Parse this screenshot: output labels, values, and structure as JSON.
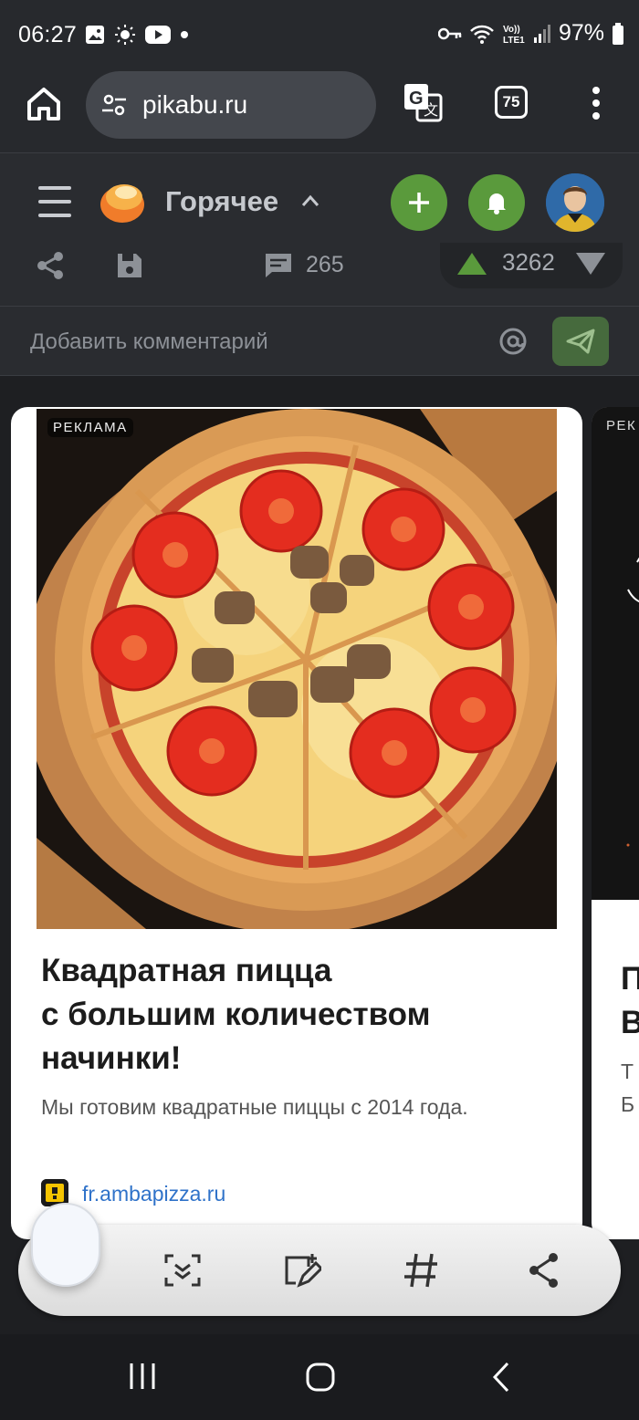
{
  "status_bar": {
    "time": "06:27",
    "battery": "97%",
    "left_icons": [
      "gallery-icon",
      "brightness-icon",
      "youtube-icon",
      "dot-icon"
    ],
    "right_icons": [
      "key-icon",
      "wifi-icon",
      "volte-lte-icon",
      "signal-icon",
      "battery-icon"
    ]
  },
  "browser": {
    "url": "pikabu.ru",
    "tab_count": "75"
  },
  "site_header": {
    "section": "Горячее"
  },
  "post_actions": {
    "comment_count": "265",
    "rating": "3262"
  },
  "comment_input": {
    "placeholder": "Добавить комментарий"
  },
  "ad": {
    "label": "РЕКЛАМА",
    "title_line1": "Квадратная пицца",
    "title_line2": "с большим количеством",
    "title_line3": "начинки!",
    "description": "Мы готовим квадратные пиццы с 2014 года.",
    "domain": "fr.ambapizza.ru"
  },
  "ad_next": {
    "label": "РЕК",
    "title_partial": "П\nВ",
    "desc_partial": "Т\nБ"
  },
  "colors": {
    "accent_green": "#5a9a3c",
    "link_blue": "#2f72c9",
    "dark_bg": "#2a2c30"
  }
}
